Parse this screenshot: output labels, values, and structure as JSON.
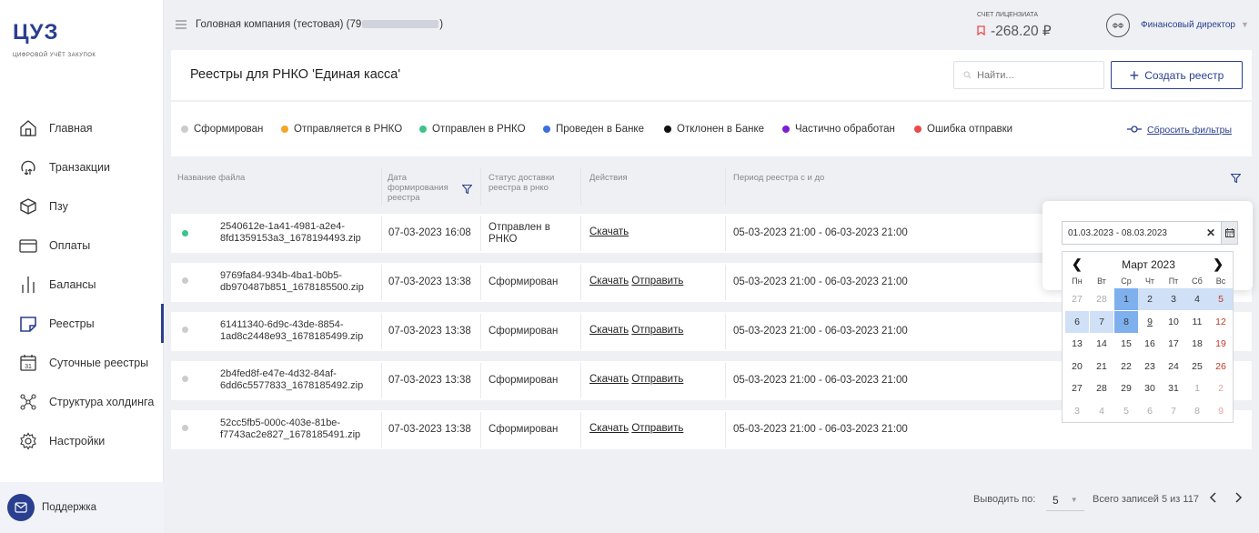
{
  "logo": {
    "main": "ЦУЗ",
    "sub": "цифровой учёт закупок"
  },
  "sidebar": {
    "items": [
      {
        "label": "Главная",
        "icon": "home-icon"
      },
      {
        "label": "Транзакции",
        "icon": "transactions-icon"
      },
      {
        "label": "Пзу",
        "icon": "box-icon"
      },
      {
        "label": "Оплаты",
        "icon": "card-icon"
      },
      {
        "label": "Балансы",
        "icon": "balance-icon"
      },
      {
        "label": "Реестры",
        "icon": "registry-icon"
      },
      {
        "label": "Суточные реестры",
        "icon": "calendar-31-icon"
      },
      {
        "label": "Структура холдинга",
        "icon": "holding-icon"
      },
      {
        "label": "Настройки",
        "icon": "gear-icon"
      }
    ],
    "support": "Поддержка"
  },
  "topbar": {
    "company_prefix": "Головная компания (тестовая) (79",
    "company_suffix": ")",
    "account_label": "СЧЕТ ЛИЦЕНЗИАТА",
    "account_value": "-268.20 ₽",
    "avatar": "ФФ",
    "role": "Финансовый директор"
  },
  "header": {
    "title": "Реестры для РНКО 'Единая касса'",
    "search_placeholder": "Найти...",
    "create_label": "Создать реестр"
  },
  "filters": [
    {
      "label": "Сформирован",
      "color": "#cccccc"
    },
    {
      "label": "Отправляется в РНКО",
      "color": "#f5a623"
    },
    {
      "label": "Отправлен в РНКО",
      "color": "#3cc48a"
    },
    {
      "label": "Проведен в Банке",
      "color": "#3b6fe0"
    },
    {
      "label": "Отклонен в Банке",
      "color": "#111111"
    },
    {
      "label": "Частично обработан",
      "color": "#7a1fd6"
    },
    {
      "label": "Ошибка отправки",
      "color": "#e94b4b"
    }
  ],
  "reset_filters": "Сбросить фильтры",
  "table": {
    "headers": {
      "file": "Название файла",
      "date": "Дата формирования реестра",
      "status": "Статус доставки реестра в рнко",
      "actions": "Действия",
      "period": "Период реестра с и до"
    },
    "rows": [
      {
        "dot": "#3cc48a",
        "file1": "2540612e-1a41-4981-a2e4-",
        "file2": "8fd1359153a3_1678194493.zip",
        "date": "07-03-2023 16:08",
        "status1": "Отправлен в",
        "status2": "РНКО",
        "download": "Скачать",
        "send": "",
        "period": "05-03-2023 21:00 - 06-03-2023 21:00"
      },
      {
        "dot": "#cccccc",
        "file1": "9769fa84-934b-4ba1-b0b5-",
        "file2": "db970487b851_1678185500.zip",
        "date": "07-03-2023 13:38",
        "status1": "Сформирован",
        "status2": "",
        "download": "Скачать",
        "send": "Отправить",
        "period": "05-03-2023 21:00 - 06-03-2023 21:00"
      },
      {
        "dot": "#cccccc",
        "file1": "61411340-6d9c-43de-8854-",
        "file2": "1ad8c2448e93_1678185499.zip",
        "date": "07-03-2023 13:38",
        "status1": "Сформирован",
        "status2": "",
        "download": "Скачать",
        "send": "Отправить",
        "period": "05-03-2023 21:00 - 06-03-2023 21:00"
      },
      {
        "dot": "#cccccc",
        "file1": "2b4fed8f-e47e-4d32-84af-",
        "file2": "6dd6c5577833_1678185492.zip",
        "date": "07-03-2023 13:38",
        "status1": "Сформирован",
        "status2": "",
        "download": "Скачать",
        "send": "Отправить",
        "period": "05-03-2023 21:00 - 06-03-2023 21:00"
      },
      {
        "dot": "#cccccc",
        "file1": "52cc5fb5-000c-403e-81be-",
        "file2": "f7743ac2e827_1678185491.zip",
        "date": "07-03-2023 13:38",
        "status1": "Сформирован",
        "status2": "",
        "download": "Скачать",
        "send": "Отправить",
        "period": "05-03-2023 21:00 - 06-03-2023 21:00"
      }
    ]
  },
  "pagination": {
    "per_page_label": "Выводить по:",
    "per_page": "5",
    "total": "Всего записей 5 из 117"
  },
  "datepicker": {
    "value": "01.03.2023 - 08.03.2023",
    "month": "Март 2023",
    "weekdays": [
      "Пн",
      "Вт",
      "Ср",
      "Чт",
      "Пт",
      "Сб",
      "Вс"
    ],
    "weeks": [
      [
        "27",
        "28",
        "1",
        "2",
        "3",
        "4",
        "5"
      ],
      [
        "6",
        "7",
        "8",
        "9",
        "10",
        "11",
        "12"
      ],
      [
        "13",
        "14",
        "15",
        "16",
        "17",
        "18",
        "19"
      ],
      [
        "20",
        "21",
        "22",
        "23",
        "24",
        "25",
        "26"
      ],
      [
        "27",
        "28",
        "29",
        "30",
        "31",
        "1",
        "2"
      ],
      [
        "3",
        "4",
        "5",
        "6",
        "7",
        "8",
        "9"
      ]
    ],
    "range_start": "1",
    "range_end": "8",
    "today": "9"
  },
  "colors": {
    "accent": "#2a3f8f",
    "range": "#cfe0f7",
    "selected": "#7fb0ee"
  }
}
